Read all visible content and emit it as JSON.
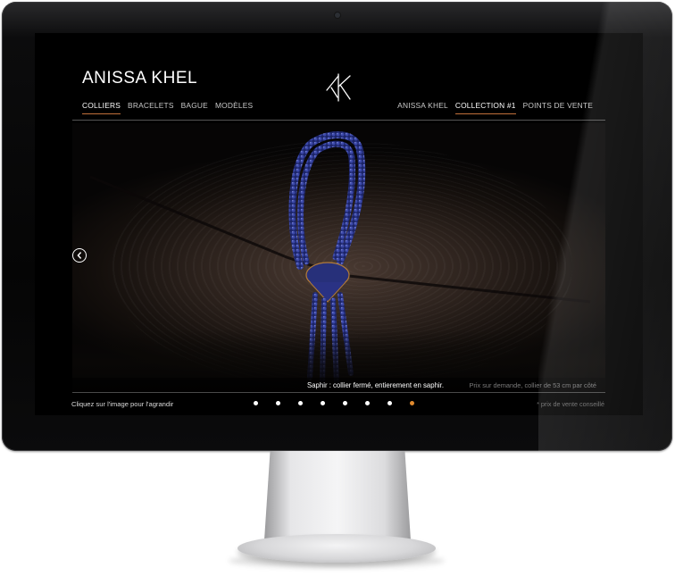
{
  "site": {
    "brand": "ANISSA KHEL",
    "logo_icon": "ak-monogram-icon",
    "nav_left": [
      {
        "label": "COLLIERS",
        "active": true
      },
      {
        "label": "BRACELETS",
        "active": false
      },
      {
        "label": "BAGUE",
        "active": false
      },
      {
        "label": "MODÈLES",
        "active": false
      }
    ],
    "nav_right": [
      {
        "label": "ANISSA KHEL",
        "active": false
      },
      {
        "label": "COLLECTION #1",
        "active": true
      },
      {
        "label": "POINTS DE VENTE",
        "active": false
      }
    ],
    "accent_color": "#c0703a"
  },
  "gallery": {
    "image": "sapphire-necklace-photo",
    "caption": "Saphir : collier fermé, entierement en saphir.",
    "price": "Prix sur demande, collier de 53 cm par côté",
    "prev_icon": "chevron-left-icon",
    "hint": "Cliquez sur l'image pour l'agrandir",
    "footnote": "* prix de vente conseillé",
    "dots_total": 8,
    "dots_active_index": 7,
    "dot_active_color": "#e08a2e"
  }
}
